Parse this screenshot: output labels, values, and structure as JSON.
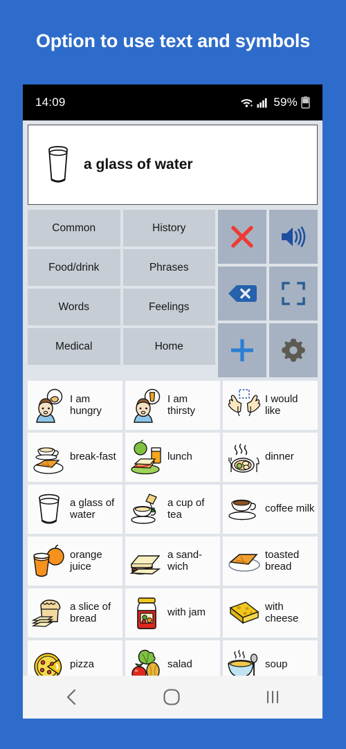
{
  "title": "Option to use text and symbols",
  "colors": {
    "background": "#2e6ccb",
    "category_button": "#c6cdd4",
    "action_button": "#a6b2c2",
    "cell": "#fbfbfc",
    "app_background": "#dfe3ea",
    "accent_blue": "#2561ad",
    "delete_red": "#ee3b33"
  },
  "statusbar": {
    "time": "14:09",
    "battery_percent": "59%",
    "wifi_icon": "wifi-icon",
    "signal_icon": "signal-bars-icon",
    "battery_icon": "battery-icon"
  },
  "message_bar": {
    "text": "a glass of water",
    "symbol": "glass-of-water-icon"
  },
  "categories": [
    {
      "label": "Common"
    },
    {
      "label": "History"
    },
    {
      "label": "Food/drink"
    },
    {
      "label": "Phrases"
    },
    {
      "label": "Words"
    },
    {
      "label": "Feelings"
    },
    {
      "label": "Medical"
    },
    {
      "label": "Home"
    }
  ],
  "actions": [
    {
      "name": "clear-button",
      "icon": "red-x-icon"
    },
    {
      "name": "speak-button",
      "icon": "speaker-icon"
    },
    {
      "name": "backspace-button",
      "icon": "backspace-icon"
    },
    {
      "name": "fullscreen-button",
      "icon": "fullscreen-icon"
    },
    {
      "name": "add-button",
      "icon": "plus-icon"
    },
    {
      "name": "settings-button",
      "icon": "gear-icon"
    }
  ],
  "symbols": [
    {
      "label": "I am hungry",
      "icon": "person-hungry-icon"
    },
    {
      "label": "I am thirsty",
      "icon": "person-thirsty-icon"
    },
    {
      "label": "I would like",
      "icon": "open-hands-icon"
    },
    {
      "label": "break-fast",
      "icon": "breakfast-icon"
    },
    {
      "label": "lunch",
      "icon": "lunch-icon"
    },
    {
      "label": "dinner",
      "icon": "dinner-icon"
    },
    {
      "label": "a glass of water",
      "icon": "glass-of-water-icon"
    },
    {
      "label": "a cup of tea",
      "icon": "cup-of-tea-icon"
    },
    {
      "label": "coffee milk",
      "icon": "coffee-milk-icon"
    },
    {
      "label": "orange juice",
      "icon": "orange-juice-icon"
    },
    {
      "label": "a sand-wich",
      "icon": "sandwich-icon"
    },
    {
      "label": "toasted bread",
      "icon": "toasted-bread-icon"
    },
    {
      "label": "a slice of bread",
      "icon": "slice-of-bread-icon"
    },
    {
      "label": "with jam",
      "icon": "jam-jar-icon"
    },
    {
      "label": "with cheese",
      "icon": "cheese-icon"
    },
    {
      "label": "pizza",
      "icon": "pizza-icon"
    },
    {
      "label": "salad",
      "icon": "salad-icon"
    },
    {
      "label": "soup",
      "icon": "soup-icon"
    }
  ],
  "navbar": [
    {
      "name": "nav-back-button",
      "icon": "chevron-left-icon"
    },
    {
      "name": "nav-home-button",
      "icon": "circle-icon"
    },
    {
      "name": "nav-recents-button",
      "icon": "bars-icon"
    }
  ]
}
